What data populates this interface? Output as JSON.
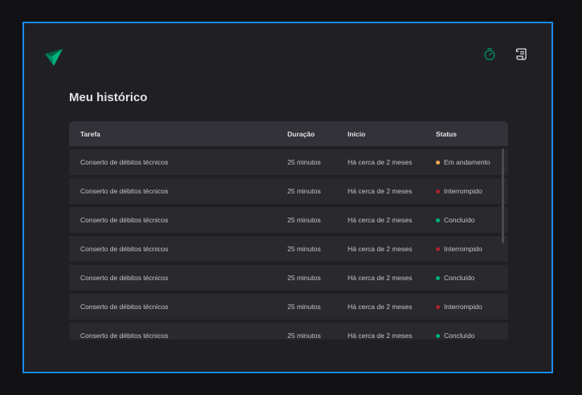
{
  "page": {
    "title": "Meu histórico"
  },
  "header": {
    "logo_icon": "triangle-logo-icon",
    "timer_icon": "timer-icon",
    "history_icon": "scroll-history-icon",
    "accent": "#00875f"
  },
  "table": {
    "headers": {
      "task": "Tarefa",
      "duration": "Duração",
      "start": "Início",
      "status": "Status"
    },
    "rows": [
      {
        "task": "Conserto de débitos técnicos",
        "duration": "25 minutos",
        "start": "Há cerca de 2 meses",
        "status": "Em andamento",
        "status_color": "#fba94c"
      },
      {
        "task": "Conserto de débitos técnicos",
        "duration": "25 minutos",
        "start": "Há cerca de 2 meses",
        "status": "Interrompido",
        "status_color": "#ab222e"
      },
      {
        "task": "Conserto de débitos técnicos",
        "duration": "25 minutos",
        "start": "Há cerca de 2 meses",
        "status": "Concluído",
        "status_color": "#00b37e"
      },
      {
        "task": "Conserto de débitos técnicos",
        "duration": "25 minutos",
        "start": "Há cerca de 2 meses",
        "status": "Interrompido",
        "status_color": "#ab222e"
      },
      {
        "task": "Conserto de débitos técnicos",
        "duration": "25 minutos",
        "start": "Há cerca de 2 meses",
        "status": "Concluído",
        "status_color": "#00b37e"
      },
      {
        "task": "Conserto de débitos técnicos",
        "duration": "25 minutos",
        "start": "Há cerca de 2 meses",
        "status": "Interrompido",
        "status_color": "#ab222e"
      },
      {
        "task": "Conserto de débitos técnicos",
        "duration": "25 minutos",
        "start": "Há cerca de 2 meses",
        "status": "Concluído",
        "status_color": "#00b37e"
      }
    ]
  }
}
